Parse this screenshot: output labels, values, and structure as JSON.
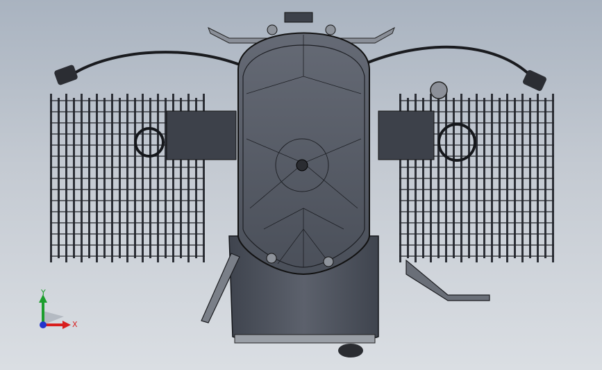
{
  "viewport": {
    "background_top": "#a9b3c0",
    "background_bottom": "#dadee3",
    "model_body_color": "#4a4f5a",
    "model_edge_color": "#15171b",
    "fin_color": "#3a3e47"
  },
  "triad": {
    "x_label": "X",
    "y_label": "Y",
    "x_color": "#d81e1e",
    "y_color": "#1c9e2d",
    "z_color": "#2233cc"
  }
}
